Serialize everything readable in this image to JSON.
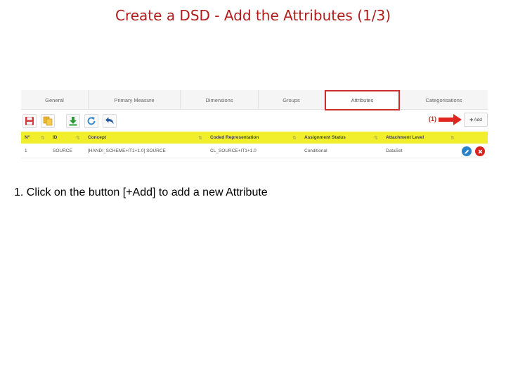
{
  "slide": {
    "title": "Create a DSD - Add the Attributes (1/3)",
    "instruction": "1.   Click on the button [+Add] to add a new Attribute"
  },
  "tabs": [
    {
      "label": "General"
    },
    {
      "label": "Primary Measure"
    },
    {
      "label": "Dimensions"
    },
    {
      "label": "Groups"
    },
    {
      "label": "Attributes",
      "active": true
    },
    {
      "label": "Categorisations"
    }
  ],
  "toolbar": {
    "icons": [
      "save-icon",
      "copy-icon",
      "download-icon",
      "refresh-icon",
      "undo-icon"
    ],
    "annotation": "(1)",
    "add_label": "Add"
  },
  "table": {
    "columns": [
      "Nº",
      "ID",
      "Concept",
      "Coded Representation",
      "Assignment Status",
      "Attachment Level"
    ],
    "rows": [
      {
        "num": "1",
        "id": "SOURCE",
        "concept": "[HANDI_SCHEME+IT1+1.0] SOURCE",
        "coded": "CL_SOURCE+IT1+1.0",
        "status": "Conditional",
        "level": "DataSet"
      }
    ]
  },
  "colors": {
    "title": "#b01c1c",
    "header_bg": "#f1ee2c",
    "active_tab_border": "#c9302c",
    "annotation": "#d9231f",
    "edit": "#2c82c9",
    "delete": "#d9231f"
  }
}
